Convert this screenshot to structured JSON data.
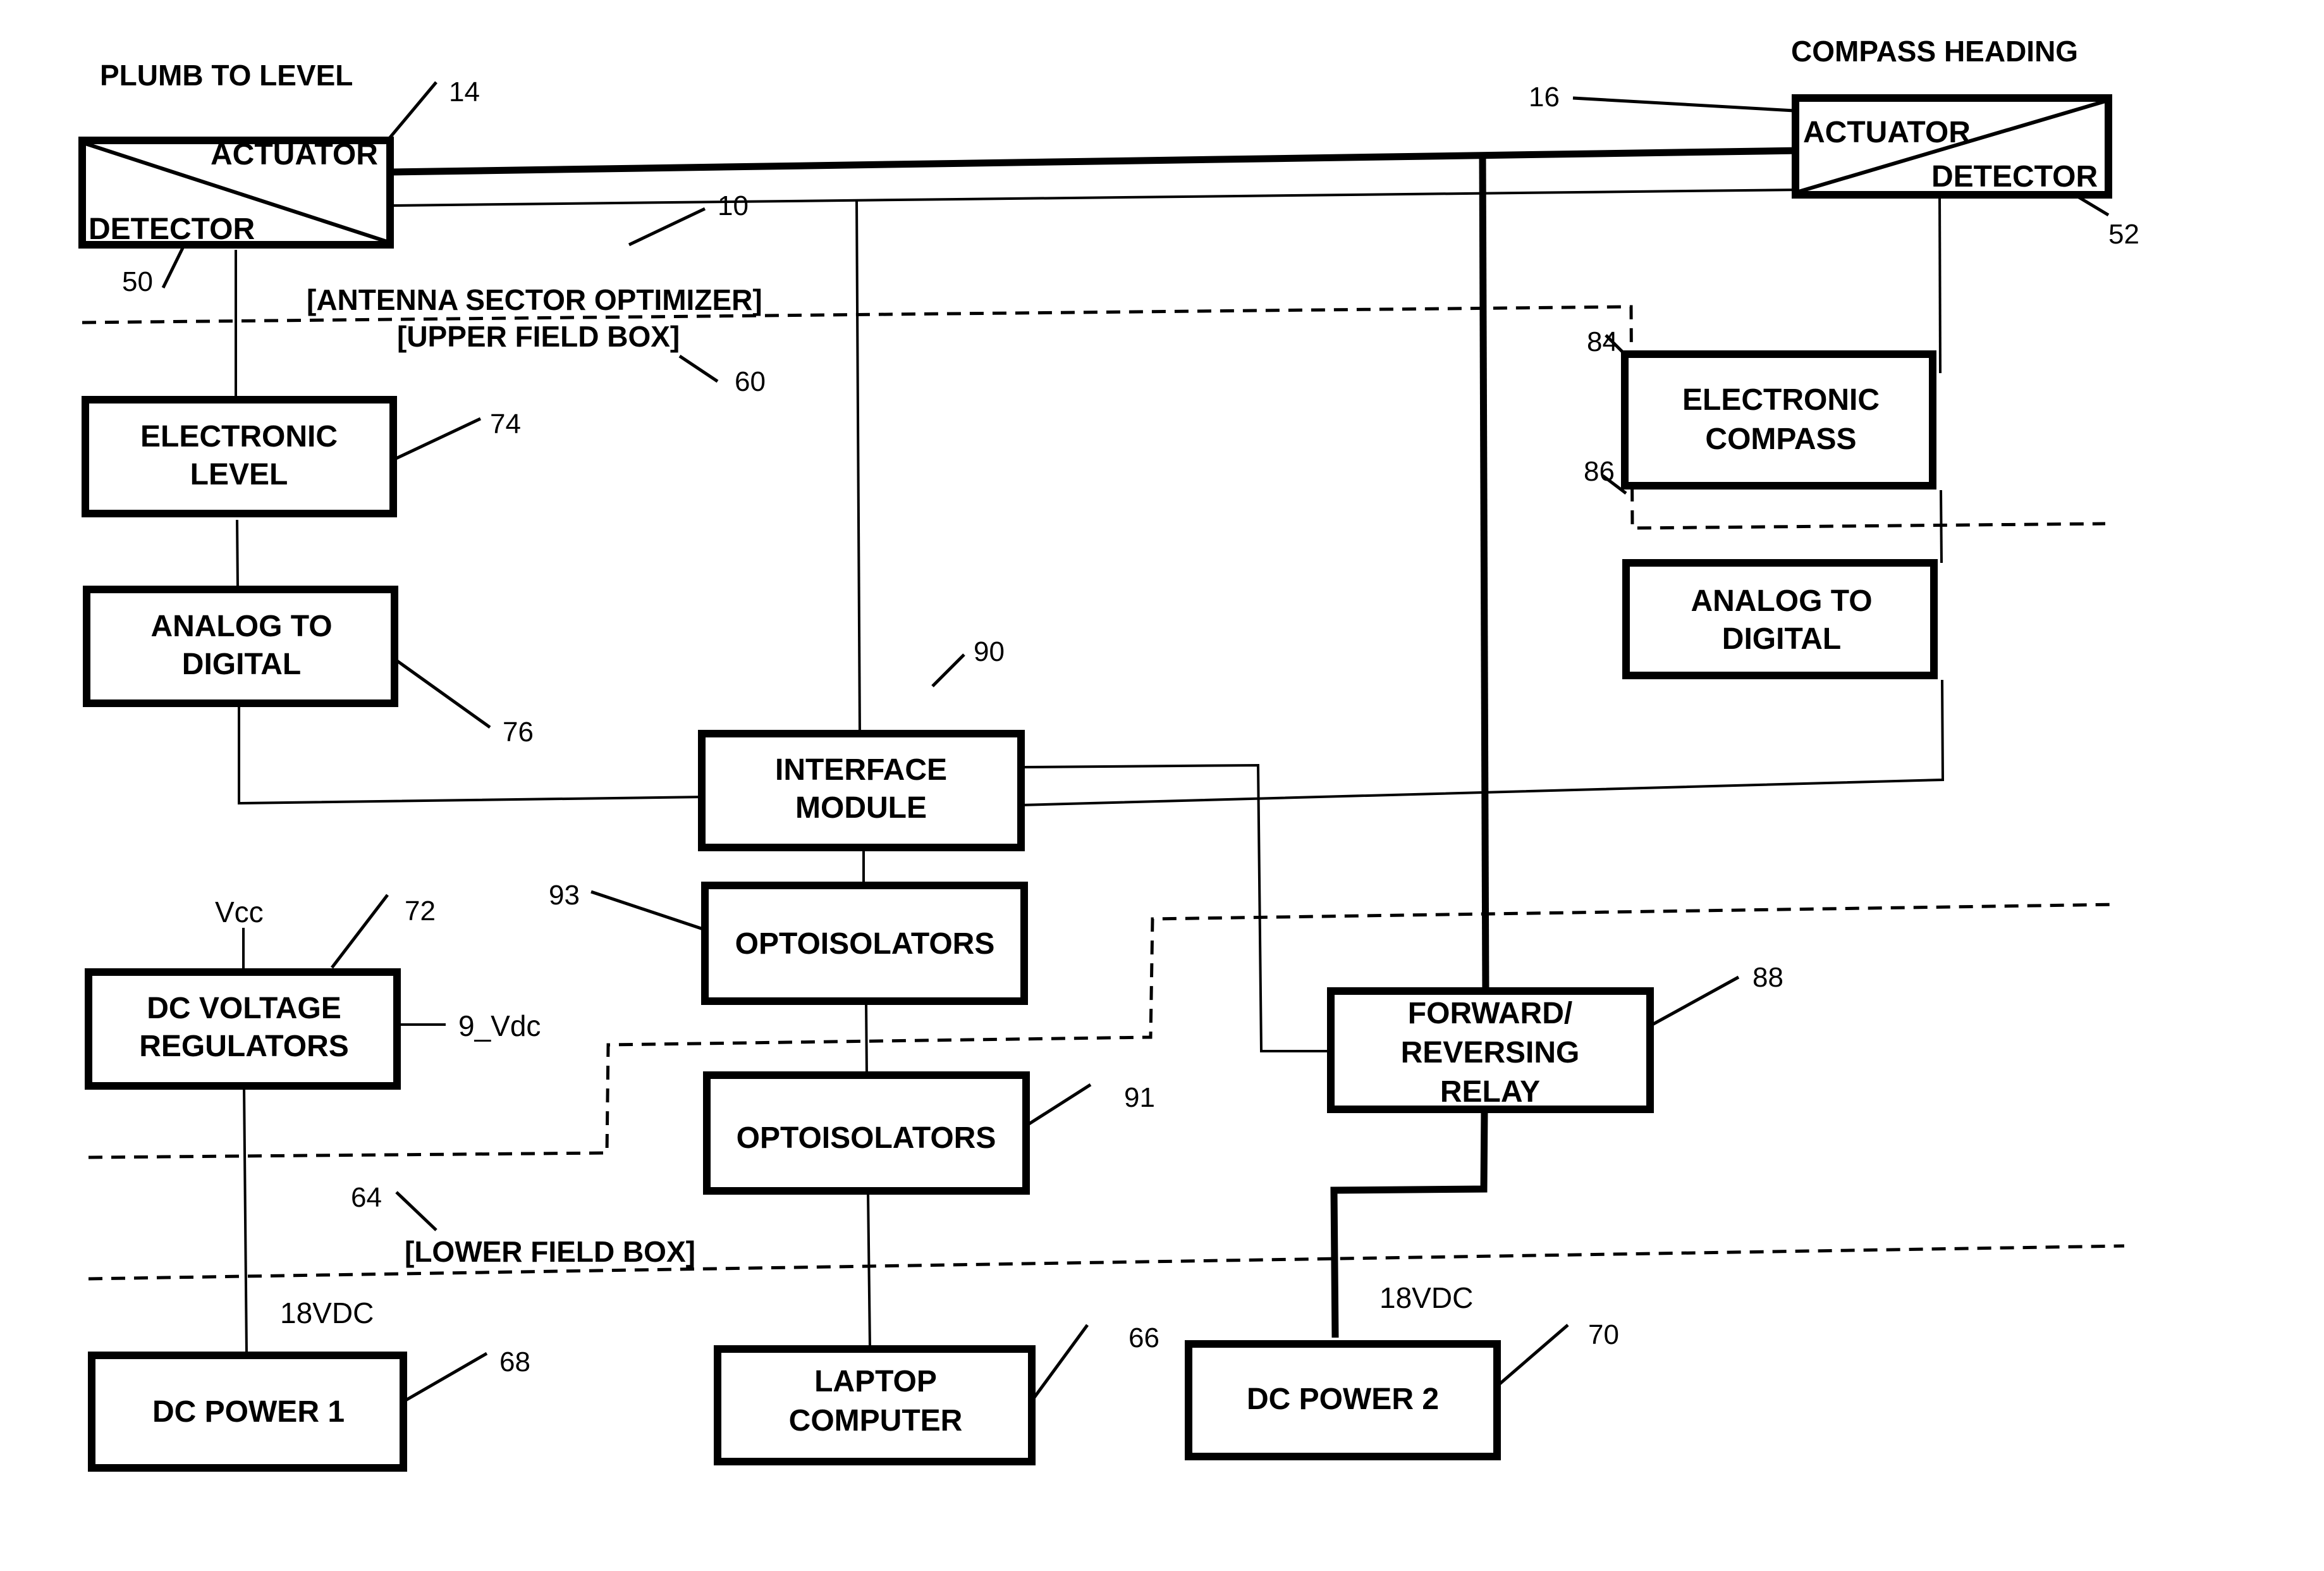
{
  "headers": {
    "left": "PLUMB TO LEVEL",
    "right": "COMPASS HEADING"
  },
  "regions": {
    "upper_title": "[ANTENNA SECTOR OPTIMIZER]",
    "upper_subtitle": "[UPPER FIELD BOX]",
    "lower_title": "[LOWER FIELD BOX]"
  },
  "blocks": {
    "plumb_actuator": {
      "top_label": "ACTUATOR",
      "bottom_label": "DETECTOR",
      "ref_top": "14",
      "ref_bottom": "50"
    },
    "compass_actuator": {
      "top_label": "ACTUATOR",
      "bottom_label": "DETECTOR",
      "ref_top": "16",
      "ref_bottom": "52"
    },
    "electronic_level": {
      "line1": "ELECTRONIC",
      "line2": "LEVEL",
      "ref": "74"
    },
    "adc_left": {
      "line1": "ANALOG TO",
      "line2": "DIGITAL",
      "ref": "76"
    },
    "electronic_compass": {
      "line1": "ELECTRONIC",
      "line2": "COMPASS",
      "ref": "84"
    },
    "adc_right": {
      "line1": "ANALOG TO",
      "line2": "DIGITAL",
      "ref": "86"
    },
    "interface_module": {
      "line1": "INTERFACE",
      "line2": "MODULE",
      "ref": "90"
    },
    "optoisolators_upper": {
      "line1": "OPTOISOLATORS",
      "ref": "93"
    },
    "optoisolators_lower": {
      "line1": "OPTOISOLATORS",
      "ref": "91"
    },
    "relay": {
      "line1": "FORWARD/",
      "line2": "REVERSING",
      "line3": "RELAY",
      "ref": "88"
    },
    "voltage_regulators": {
      "line1": "DC VOLTAGE",
      "line2": "REGULATORS",
      "ref": "72",
      "input_label": "Vcc",
      "output_label": "9_Vdc"
    },
    "dc_power_1": {
      "line1": "DC POWER 1",
      "ref": "68",
      "supply_label": "18VDC"
    },
    "laptop": {
      "line1": "LAPTOP",
      "line2": "COMPUTER",
      "ref": "66"
    },
    "dc_power_2": {
      "line1": "DC POWER 2",
      "ref": "70",
      "supply_label": "18VDC"
    }
  },
  "reference_numerals": {
    "system": "10",
    "upper_field_box": "60",
    "lower_field_box": "64"
  }
}
